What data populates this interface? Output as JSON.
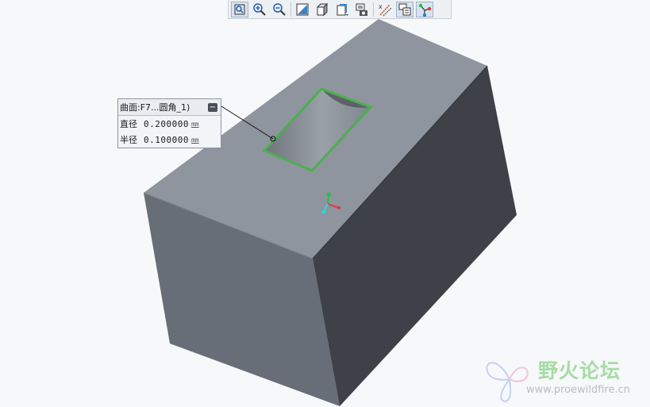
{
  "toolbar": {
    "buttons": [
      {
        "icon": "refit-zoom-icon",
        "active": true
      },
      {
        "icon": "zoom-in-icon",
        "active": false
      },
      {
        "icon": "zoom-out-icon",
        "active": false
      },
      {
        "icon": "repaint-icon",
        "active": false
      },
      {
        "icon": "display-style-icon",
        "active": false
      },
      {
        "icon": "saved-orientations-icon",
        "active": false
      },
      {
        "icon": "view-manager-icon",
        "active": false
      },
      {
        "icon": "datum-display-icon",
        "active": false
      },
      {
        "icon": "annotation-display-icon",
        "active": true
      },
      {
        "icon": "spin-center-icon",
        "active": true
      }
    ]
  },
  "callout": {
    "title": "曲面:F7...圆角_1)",
    "rows": [
      {
        "label": "直径",
        "value": "0.200000",
        "unit": "mm"
      },
      {
        "label": "半径",
        "value": "0.100000",
        "unit": "mm"
      }
    ]
  },
  "watermark": {
    "title": "野火论坛",
    "url": "www.proewildfire.cn"
  },
  "colors": {
    "background": "#f7f8fa",
    "top_face": "#8e959e",
    "front_face": "#686e77",
    "right_face": "#3e4248",
    "highlight": "#4caf50"
  }
}
